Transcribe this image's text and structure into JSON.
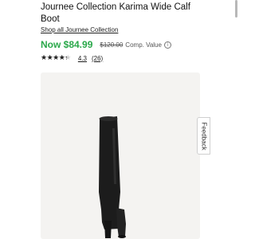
{
  "product": {
    "title": "Journee Collection Karima Wide Calf Boot",
    "shop_link": "Shop all Journee Collection"
  },
  "price": {
    "now": "Now $84.99",
    "was": "$120.00",
    "comp_label": "Comp. Value",
    "info_icon": "info-icon"
  },
  "rating": {
    "value": 4.3,
    "value_text": "4.3",
    "review_count": "(26)",
    "max_stars": 5,
    "star_glyphs": "★★★★★"
  },
  "image": {
    "alt": "Black knee-high heeled boot"
  },
  "feedback": {
    "label": "Feedback"
  },
  "colors": {
    "price_green": "#2aa84a",
    "image_bg": "#f4f3f1",
    "boot": "#1c1c1c"
  }
}
